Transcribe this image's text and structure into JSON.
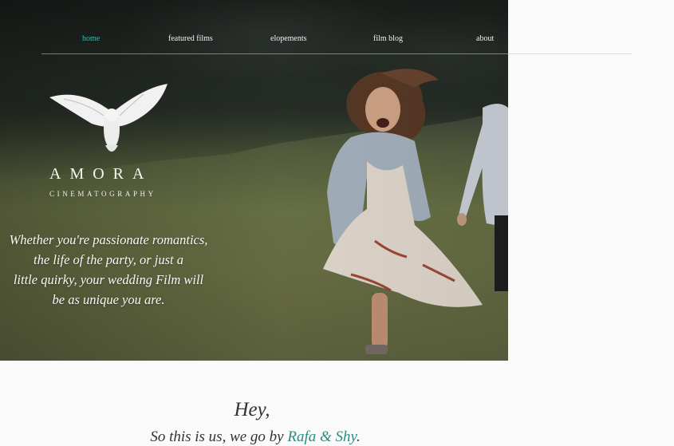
{
  "nav": {
    "items": [
      {
        "label": "home",
        "active": true
      },
      {
        "label": "featured films",
        "active": false
      },
      {
        "label": "elopements",
        "active": false
      },
      {
        "label": "film blog",
        "active": false
      },
      {
        "label": "about",
        "active": false
      }
    ]
  },
  "brand": {
    "logo_icon": "owl-icon",
    "name": "AMORA",
    "subtitle": "CINEMATOGRAPHY"
  },
  "hero": {
    "tagline_lines": [
      "Whether you're passionate romantics,",
      "the life of the party, or just a",
      "little quirky, your wedding Film will",
      "be as unique you are."
    ]
  },
  "intro": {
    "greeting": "Hey,",
    "line_prefix": "So this is us, we go by ",
    "names": "Rafa & Shy",
    "line_suffix": "."
  },
  "colors": {
    "accent": "#3bb9b0",
    "names_accent": "#2c8c82",
    "text_dark": "#333333",
    "page_background": "#fafafa"
  }
}
